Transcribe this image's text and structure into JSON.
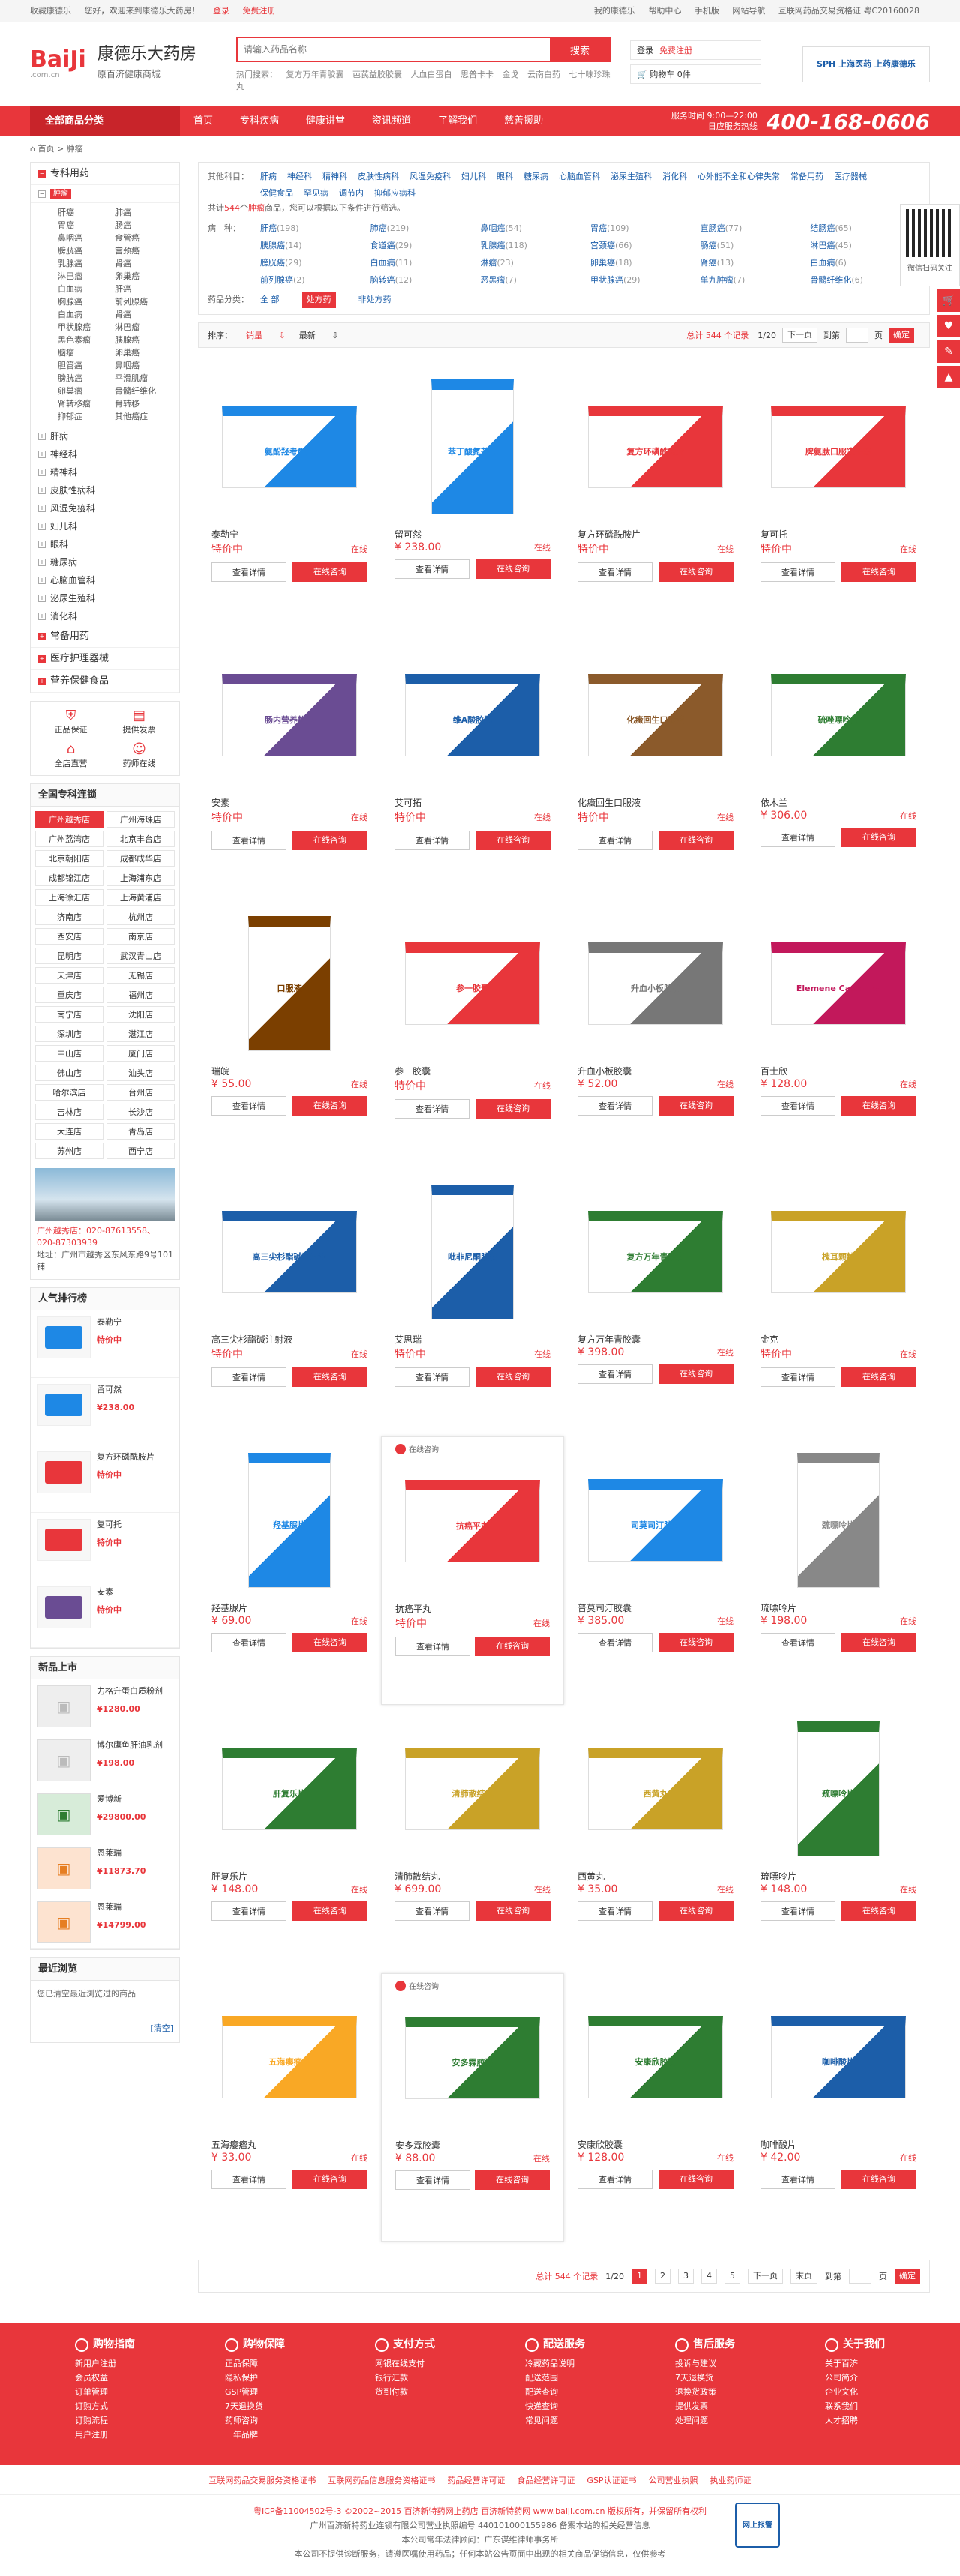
{
  "topbar": {
    "favorite": "收藏康德乐",
    "welcome": "您好，欢迎来到康德乐大药房！",
    "login": "登录",
    "register": "免费注册",
    "my": "我的康德乐",
    "help": "帮助中心",
    "mobile": "手机版",
    "nav": "网站导航",
    "license": "互联网药品交易资格证 粤C20160028"
  },
  "logo": {
    "main": "BaiJi",
    "sub": ".com.cn",
    "name": "康德乐大药房",
    "slogan": "原百济健康商城"
  },
  "search": {
    "placeholder": "请输入药品名称",
    "button": "搜索",
    "hot_label": "热门搜索：",
    "hot": [
      "复方万年青胶囊",
      "芭芪益胶胶囊",
      "人血白蛋白",
      "思普卡卡",
      "金戈",
      "云南白药",
      "七十味珍珠丸"
    ]
  },
  "user": {
    "login": "登录",
    "register": "免费注册",
    "cart": "购物车 0件"
  },
  "badge": {
    "text": "SPH 上海医药 上药康德乐"
  },
  "nav": {
    "category": "全部商品分类",
    "items": [
      "首页",
      "专科疾病",
      "健康讲堂",
      "资讯频道",
      "了解我们",
      "慈善援助"
    ],
    "service_time": "服务时间 9:00—22:00",
    "service_note": "日应服务热线",
    "phone": "400-168-0606"
  },
  "crumb": {
    "home": "首页",
    "current": "肿瘤"
  },
  "sidebar": {
    "title": "专科用药",
    "active": "肿瘤",
    "sub_items": [
      "肝癌",
      "肺癌",
      "胃癌",
      "肠癌",
      "鼻咽癌",
      "食管癌",
      "膀胱癌",
      "宫颈癌",
      "乳腺癌",
      "肾癌",
      "淋巴瘤",
      "卵巢癌",
      "白血病",
      "肝癌",
      "胸腺癌",
      "前列腺癌",
      "白血病",
      "肾癌",
      "甲状腺癌",
      "淋巴瘤",
      "黑色素瘤",
      "胰腺癌",
      "脑瘤",
      "卵巢癌",
      "胆管癌",
      "鼻咽癌",
      "膀胱癌",
      "平滑肌瘤",
      "卵巢瘤",
      "骨髓纤维化",
      "肾转移瘤",
      "骨转移",
      "抑郁症",
      "其他癌症"
    ],
    "categories": [
      "肝病",
      "神经科",
      "精神科",
      "皮肤性病科",
      "风湿免疫科",
      "妇儿科",
      "眼科",
      "糖尿病",
      "心脑血管科",
      "泌尿生殖科",
      "消化科"
    ],
    "big": [
      "常备用药",
      "医疗护理器械",
      "营养保健食品"
    ],
    "services": [
      "正品保证",
      "提供发票",
      "全店直营",
      "药师在线"
    ],
    "stores_title": "全国专科连锁",
    "stores": [
      "广州越秀店",
      "广州海珠店",
      "广州荔湾店",
      "北京丰台店",
      "北京朝阳店",
      "成都成华店",
      "成都锦江店",
      "上海浦东店",
      "上海徐汇店",
      "上海黄浦店",
      "济南店",
      "杭州店",
      "西安店",
      "南京店",
      "昆明店",
      "武汉青山店",
      "天津店",
      "无锡店",
      "重庆店",
      "福州店",
      "南宁店",
      "沈阳店",
      "深圳店",
      "湛江店",
      "中山店",
      "厦门店",
      "佛山店",
      "汕头店",
      "哈尔滨店",
      "台州店",
      "吉林店",
      "长沙店",
      "大连店",
      "青岛店",
      "苏州店",
      "西宁店"
    ],
    "store_phone_label": "广州越秀店：",
    "store_phone": "020-87613558、020-87303939",
    "store_addr": "地址：广州市越秀区东风东路9号101铺",
    "rank_title": "人气排行榜",
    "rank": [
      {
        "name": "泰勒宁",
        "price": "特价中"
      },
      {
        "name": "留可然",
        "price": "¥238.00"
      },
      {
        "name": "复方环磷酰胺片",
        "price": "特价中"
      },
      {
        "name": "复可托",
        "price": "特价中"
      },
      {
        "name": "安素",
        "price": "特价中"
      }
    ],
    "new_title": "新品上市",
    "new": [
      {
        "name": "力格升蛋白质粉剂",
        "price": "¥1280.00"
      },
      {
        "name": "博尔鹰鱼肝油乳剂",
        "price": "¥198.00"
      },
      {
        "name": "爱博新",
        "price": "¥29800.00"
      },
      {
        "name": "恩莱瑞",
        "price": "¥11873.70"
      },
      {
        "name": "恩莱瑞",
        "price": "¥14799.00"
      }
    ],
    "recent_title": "最近浏览",
    "recent_text": "您已清空最近浏览过的商品",
    "recent_clear": "[清空]"
  },
  "filter": {
    "brand_label": "其他科目：",
    "brands": [
      "肝病",
      "神经科",
      "精神科",
      "皮肤性病科",
      "风湿免疫科",
      "妇儿科",
      "眼科",
      "糖尿病",
      "心脑血管科",
      "泌尿生殖科",
      "消化科",
      "心外能不全和心律失常",
      "常备用药",
      "医疗器械",
      "保健食品",
      "罕见病",
      "调节内",
      "抑郁应病科"
    ],
    "tip_prefix": "共计",
    "tip_count": "544",
    "tip_mid": "个",
    "tip_keyword": "肿瘤",
    "tip_suffix": "商品，您可以根据以下条件进行筛选。",
    "disease_label": "病　种：",
    "diseases": [
      [
        "肝癌",
        "(198)"
      ],
      [
        "肺癌",
        "(219)"
      ],
      [
        "鼻咽癌",
        "(54)"
      ],
      [
        "胃癌",
        "(109)"
      ],
      [
        "直肠癌",
        "(77)"
      ],
      [
        "结肠癌",
        "(65)"
      ],
      [
        "胰腺癌",
        "(14)"
      ],
      [
        "食道癌",
        "(29)"
      ],
      [
        "乳腺癌",
        "(118)"
      ],
      [
        "宫颈癌",
        "(66)"
      ],
      [
        "肠癌",
        "(51)"
      ],
      [
        "淋巴癌",
        "(45)"
      ],
      [
        "膀胱癌",
        "(29)"
      ],
      [
        "白血病",
        "(11)"
      ],
      [
        "淋瘤",
        "(23)"
      ],
      [
        "卵巢癌",
        "(18)"
      ],
      [
        "肾癌",
        "(13)"
      ],
      [
        "白血病",
        "(6)"
      ],
      [
        "前列腺癌",
        "(2)"
      ],
      [
        "脑转癌",
        "(12)"
      ],
      [
        "恶黑瘤",
        "(7)"
      ],
      [
        "甲状腺癌",
        "(29)"
      ],
      [
        "单九肿瘤",
        "(7)"
      ],
      [
        "骨髓纤维化",
        "(6)"
      ]
    ],
    "type_label": "药品分类：",
    "types": [
      "全 部",
      "处方药",
      "非处方药"
    ]
  },
  "sort": {
    "label": "排序：",
    "items": [
      "销量",
      "最新"
    ],
    "count": "总计 544 个记录",
    "page": "1/20",
    "next": "下一页",
    "jump": "到第",
    "unit": "页",
    "go": "确定"
  },
  "products": [
    {
      "name": "泰勒宁",
      "price": "特价中",
      "status": "在线",
      "view": "查看详情",
      "chat": "在线咨询",
      "label": "氨酚羟考酮片",
      "color": "#1e88e5"
    },
    {
      "name": "留可然",
      "price": "¥ 238.00",
      "status": "在线",
      "view": "查看详情",
      "chat": "在线咨询",
      "label": "苯丁酸氮芥片",
      "color": "#1e88e5"
    },
    {
      "name": "复方环磷酰胺片",
      "price": "特价中",
      "status": "在线",
      "view": "查看详情",
      "chat": "在线咨询",
      "label": "复方环磷酰胺片",
      "color": "#e8363b"
    },
    {
      "name": "复可托",
      "price": "特价中",
      "status": "在线",
      "view": "查看详情",
      "chat": "在线咨询",
      "label": "脾氨肽口服冻干粉",
      "color": "#e8363b"
    },
    {
      "name": "安素",
      "price": "特价中",
      "status": "在线",
      "view": "查看详情",
      "chat": "在线咨询",
      "label": "肠内营养粉剂",
      "color": "#6a4c93"
    },
    {
      "name": "艾可拓",
      "price": "特价中",
      "status": "在线",
      "view": "查看详情",
      "chat": "在线咨询",
      "label": "维A酸胶囊",
      "color": "#1c5ea9"
    },
    {
      "name": "化癥回生口服液",
      "price": "特价中",
      "status": "在线",
      "view": "查看详情",
      "chat": "在线咨询",
      "label": "化癥回生口服液",
      "color": "#8b5a2b"
    },
    {
      "name": "依木兰",
      "price": "¥ 306.00",
      "status": "在线",
      "view": "查看详情",
      "chat": "在线咨询",
      "label": "硫唑嘌呤片",
      "color": "#2e7d32"
    },
    {
      "name": "瑞皖",
      "price": "¥ 55.00",
      "status": "在线",
      "view": "查看详情",
      "chat": "在线咨询",
      "label": "口服液",
      "color": "#7b3f00"
    },
    {
      "name": "参一胶囊",
      "price": "特价中",
      "status": "在线",
      "view": "查看详情",
      "chat": "在线咨询",
      "label": "参一胶囊",
      "color": "#e8363b"
    },
    {
      "name": "升血小板胶囊",
      "price": "¥ 52.00",
      "status": "在线",
      "view": "查看详情",
      "chat": "在线咨询",
      "label": "升血小板胶囊",
      "color": "#777"
    },
    {
      "name": "百士欣",
      "price": "¥ 128.00",
      "status": "在线",
      "view": "查看详情",
      "chat": "在线咨询",
      "label": "Elemene Capsules",
      "color": "#c2185b"
    },
    {
      "name": "高三尖杉酯碱注射液",
      "price": "特价中",
      "status": "在线",
      "view": "查看详情",
      "chat": "在线咨询",
      "label": "高三尖杉酯碱注射液",
      "color": "#1c5ea9"
    },
    {
      "name": "艾思瑞",
      "price": "特价中",
      "status": "在线",
      "view": "查看详情",
      "chat": "在线咨询",
      "label": "吡非尼酮胶囊",
      "color": "#1c5ea9"
    },
    {
      "name": "复方万年青胶囊",
      "price": "¥ 398.00",
      "status": "在线",
      "view": "查看详情",
      "chat": "在线咨询",
      "label": "复方万年青胶囊",
      "color": "#2e7d32"
    },
    {
      "name": "金克",
      "price": "特价中",
      "status": "在线",
      "view": "查看详情",
      "chat": "在线咨询",
      "label": "槐耳颗粒",
      "color": "#c9a227"
    },
    {
      "name": "羟基脲片",
      "price": "¥ 69.00",
      "status": "在线",
      "view": "查看详情",
      "chat": "在线咨询",
      "label": "羟基脲片",
      "color": "#1e88e5"
    },
    {
      "name": "抗癌平丸",
      "price": "特价中",
      "status": "在线",
      "view": "查看详情",
      "chat": "在线咨询",
      "label": "抗癌平丸",
      "color": "#e8363b",
      "badge": "在线咨询"
    },
    {
      "name": "普莫司汀胶囊",
      "price": "¥ 385.00",
      "status": "在线",
      "view": "查看详情",
      "chat": "在线咨询",
      "label": "司莫司汀胶囊",
      "color": "#1e88e5"
    },
    {
      "name": "琉嘌呤片",
      "price": "¥ 198.00",
      "status": "在线",
      "view": "查看详情",
      "chat": "在线咨询",
      "label": "巯嘌呤片",
      "color": "#888"
    },
    {
      "name": "肝复乐片",
      "price": "¥ 148.00",
      "status": "在线",
      "view": "查看详情",
      "chat": "在线咨询",
      "label": "肝复乐片",
      "color": "#2e7d32"
    },
    {
      "name": "清肺散结丸",
      "price": "¥ 699.00",
      "status": "在线",
      "view": "查看详情",
      "chat": "在线咨询",
      "label": "清肺散结丸",
      "color": "#c9a227"
    },
    {
      "name": "西黄丸",
      "price": "¥ 35.00",
      "status": "在线",
      "view": "查看详情",
      "chat": "在线咨询",
      "label": "西黄丸",
      "color": "#c9a227"
    },
    {
      "name": "琉嘌呤片",
      "price": "¥ 148.00",
      "status": "在线",
      "view": "查看详情",
      "chat": "在线咨询",
      "label": "巯嘌呤片",
      "color": "#2e7d32"
    },
    {
      "name": "五海瘿瘤丸",
      "price": "¥ 33.00",
      "status": "在线",
      "view": "查看详情",
      "chat": "在线咨询",
      "label": "五海瘿瘤丸",
      "color": "#f9a825"
    },
    {
      "name": "安多霖胶囊",
      "price": "¥ 88.00",
      "status": "在线",
      "view": "查看详情",
      "chat": "在线咨询",
      "label": "安多霖胶囊",
      "color": "#2e7d32",
      "badge": "在线咨询"
    },
    {
      "name": "安康欣胶囊",
      "price": "¥ 128.00",
      "status": "在线",
      "view": "查看详情",
      "chat": "在线咨询",
      "label": "安康欣胶囊",
      "color": "#2e7d32"
    },
    {
      "name": "咖啡酸片",
      "price": "¥ 42.00",
      "status": "在线",
      "view": "查看详情",
      "chat": "在线咨询",
      "label": "咖啡酸片",
      "color": "#1c5ea9"
    }
  ],
  "pager": {
    "count": "总计 544 个记录",
    "page": "1/20",
    "pages": [
      "1",
      "2",
      "3",
      "4",
      "5"
    ],
    "next": "下一页",
    "last": "末页",
    "jump": "到第",
    "unit": "页",
    "go": "确定"
  },
  "footer": {
    "cols": [
      {
        "title": "购物指南",
        "items": [
          "新用户注册",
          "会员权益",
          "订单管理",
          "订购方式",
          "订购流程",
          "用户注册"
        ]
      },
      {
        "title": "购物保障",
        "items": [
          "正品保障",
          "隐私保护",
          "GSP管理",
          "7天退换货",
          "药师咨询",
          "十年品牌"
        ]
      },
      {
        "title": "支付方式",
        "items": [
          "网银在线支付",
          "银行汇款",
          "货到付款"
        ]
      },
      {
        "title": "配送服务",
        "items": [
          "冷藏药品说明",
          "配送范围",
          "配送查询",
          "快递查询",
          "常见问题"
        ]
      },
      {
        "title": "售后服务",
        "items": [
          "投诉与建议",
          "7天退换货",
          "退换货政策",
          "提供发票",
          "处理问题"
        ]
      },
      {
        "title": "关于我们",
        "items": [
          "关于百济",
          "公司简介",
          "企业文化",
          "联系我们",
          "人才招聘"
        ]
      }
    ],
    "links": [
      "互联网药品交易服务资格证书",
      "互联网药品信息服务资格证书",
      "药品经营许可证",
      "食品经营许可证",
      "GSP认证证书",
      "公司营业执照",
      "执业药师证"
    ],
    "copy1": "粤ICP备11004502号-3 ©2002~2015 百济新特药网上药店 百济新特药网 www.baiji.com.cn 版权所有，并保留所有权利",
    "copy2": "广州百济新特药业连锁有限公司营业执照编号 440101000155986 备案本站的相关经营信息",
    "copy3": "本公司常年法律顾问：广东谋维律师事务所",
    "copy4": "本公司不提供诊断服务，请遵医嘱使用药品；任何本站公告页面中出现的相关商品促销信息，仅供参考",
    "emblem": "网上报警"
  },
  "float": {
    "qr_text": "微信扫码关注"
  }
}
